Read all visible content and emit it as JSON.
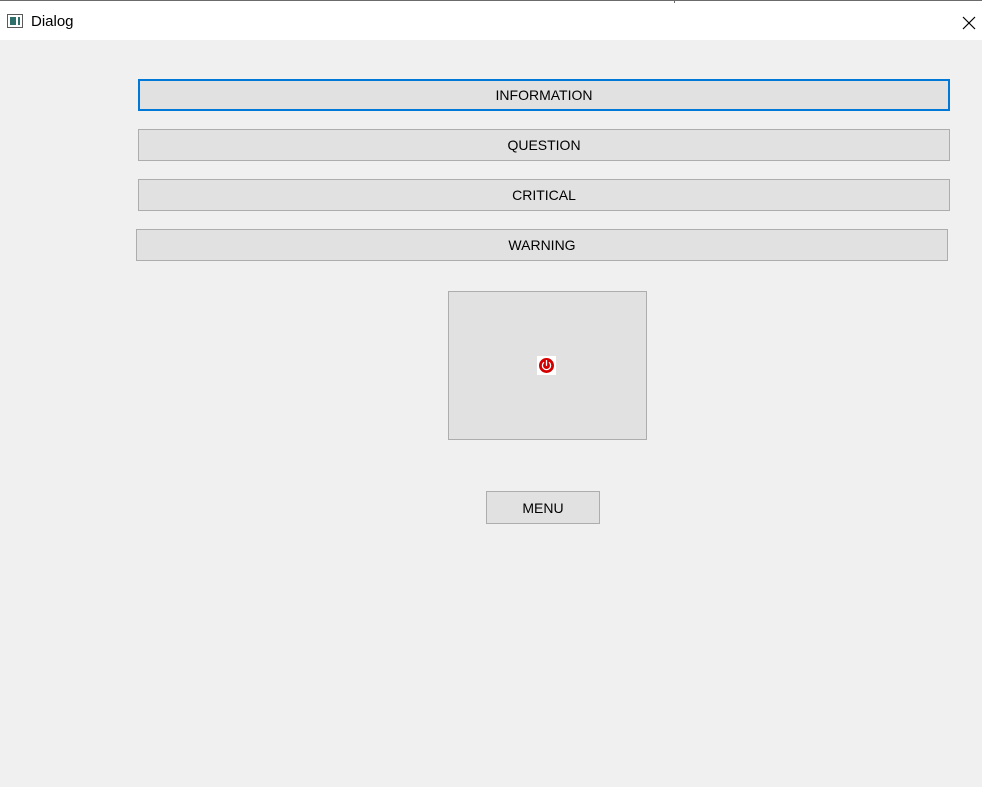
{
  "window": {
    "title": "Dialog",
    "icon": "window-app-icon",
    "close_icon": "close-icon"
  },
  "buttons": {
    "information": "INFORMATION",
    "question": "QUESTION",
    "critical": "CRITICAL",
    "warning": "WARNING"
  },
  "icon_panel": {
    "icon": "critical-power-icon",
    "icon_color": "#d40000"
  },
  "menu_button": "MENU",
  "colors": {
    "focus_border": "#0078d7",
    "button_face": "#e1e1e1",
    "window_background": "#f0f0f0"
  }
}
